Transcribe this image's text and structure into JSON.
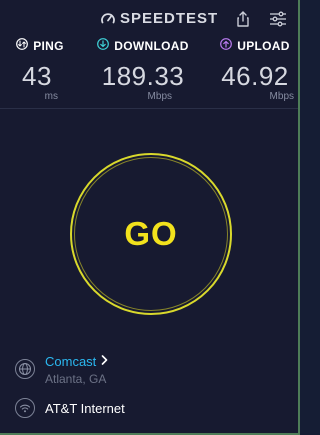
{
  "header": {
    "brand": "SPEEDTEST",
    "share_icon": "share-icon",
    "settings_icon": "settings-sliders-icon"
  },
  "metrics": {
    "ping": {
      "label": "PING",
      "value": "43",
      "unit": "ms",
      "icon": "ping-icon",
      "color": "#ffffff"
    },
    "download": {
      "label": "DOWNLOAD",
      "value": "189.33",
      "unit": "Mbps",
      "icon": "download-arrow-icon",
      "color": "#3fd2d8"
    },
    "upload": {
      "label": "UPLOAD",
      "value": "46.92",
      "unit": "Mbps",
      "icon": "upload-arrow-icon",
      "color": "#b97bf0"
    }
  },
  "go_button": {
    "label": "GO",
    "color": "#f2e21d"
  },
  "isp": {
    "name": "Comcast",
    "location": "Atlanta, GA",
    "icon": "globe-icon"
  },
  "network": {
    "name": "AT&T Internet",
    "icon": "wifi-icon"
  },
  "colors": {
    "background": "#171a30",
    "accent_blue": "#2bb8f0",
    "accent_yellow": "#f2e21d"
  }
}
